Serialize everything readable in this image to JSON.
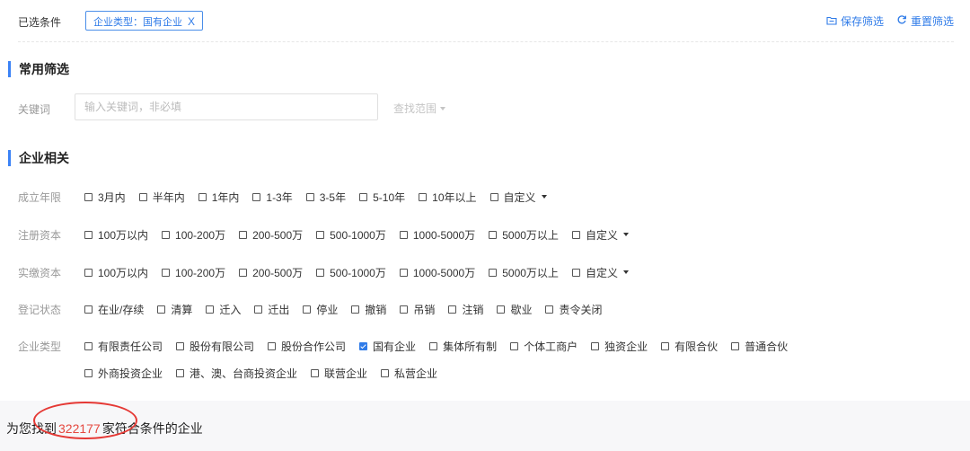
{
  "selected": {
    "label": "已选条件",
    "tag": "企业类型：国有企业",
    "tag_close": "X",
    "save_label": "保存筛选",
    "reset_label": "重置筛选"
  },
  "common": {
    "title": "常用筛选",
    "keyword_label": "关键词",
    "keyword_placeholder": "输入关键词，非必填",
    "scope_label": "查找范围"
  },
  "company": {
    "title": "企业相关",
    "rows": [
      {
        "label": "成立年限",
        "options": [
          "3月内",
          "半年内",
          "1年内",
          "1-3年",
          "3-5年",
          "5-10年",
          "10年以上"
        ],
        "custom": "自定义"
      },
      {
        "label": "注册资本",
        "options": [
          "100万以内",
          "100-200万",
          "200-500万",
          "500-1000万",
          "1000-5000万",
          "5000万以上"
        ],
        "custom": "自定义"
      },
      {
        "label": "实缴资本",
        "options": [
          "100万以内",
          "100-200万",
          "200-500万",
          "500-1000万",
          "1000-5000万",
          "5000万以上"
        ],
        "custom": "自定义"
      },
      {
        "label": "登记状态",
        "options": [
          "在业/存续",
          "清算",
          "迁入",
          "迁出",
          "停业",
          "撤销",
          "吊销",
          "注销",
          "歇业",
          "责令关闭"
        ]
      },
      {
        "label": "企业类型",
        "options": [
          "有限责任公司",
          "股份有限公司",
          "股份合作公司",
          "国有企业",
          "集体所有制",
          "个体工商户",
          "独资企业",
          "有限合伙",
          "普通合伙"
        ],
        "checked": "国有企业",
        "options_line2": [
          "外商投资企业",
          "港、澳、台商投资企业",
          "联营企业",
          "私营企业"
        ]
      }
    ]
  },
  "result": {
    "prefix": "为您找到",
    "count": "322177",
    "suffix": "家符合条件的企业"
  },
  "colors": {
    "accent": "#2f7be8",
    "highlight": "#e5483f",
    "annotation": "#e53935"
  }
}
